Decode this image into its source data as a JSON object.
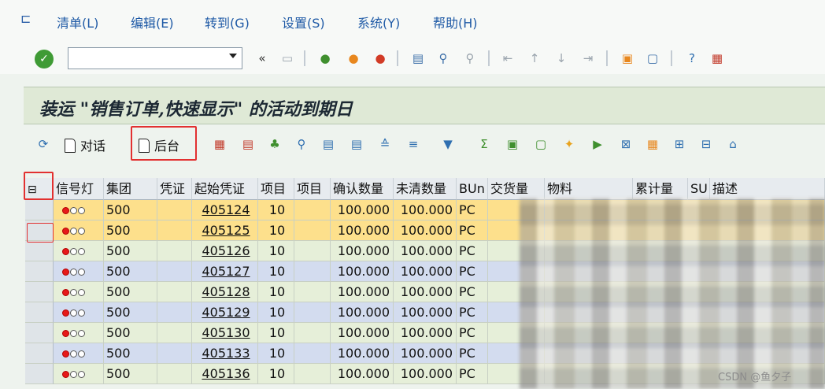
{
  "menu": [
    "清单(L)",
    "编辑(E)",
    "转到(G)",
    "设置(S)",
    "系统(Y)",
    "帮助(H)"
  ],
  "command_field": {
    "value": ""
  },
  "screen_title": "装运 \"销售订单,快速显示\" 的活动到期日",
  "alv_toolbar": {
    "dialog_label": "对话",
    "background_label": "后台"
  },
  "table": {
    "headers": [
      "信号灯",
      "集团",
      "凭证",
      "起始凭证",
      "项目",
      "项目",
      "确认数量",
      "未清数量",
      "BUn",
      "交货量",
      "物料",
      "累计量",
      "SU",
      "描述"
    ],
    "rows": [
      {
        "group": "500",
        "doc": "405124",
        "item": "10",
        "confirmed": "100.000",
        "open": "100.000",
        "bun": "PC"
      },
      {
        "group": "500",
        "doc": "405125",
        "item": "10",
        "confirmed": "100.000",
        "open": "100.000",
        "bun": "PC"
      },
      {
        "group": "500",
        "doc": "405126",
        "item": "10",
        "confirmed": "100.000",
        "open": "100.000",
        "bun": "PC"
      },
      {
        "group": "500",
        "doc": "405127",
        "item": "10",
        "confirmed": "100.000",
        "open": "100.000",
        "bun": "PC"
      },
      {
        "group": "500",
        "doc": "405128",
        "item": "10",
        "confirmed": "100.000",
        "open": "100.000",
        "bun": "PC"
      },
      {
        "group": "500",
        "doc": "405129",
        "item": "10",
        "confirmed": "100.000",
        "open": "100.000",
        "bun": "PC"
      },
      {
        "group": "500",
        "doc": "405130",
        "item": "10",
        "confirmed": "100.000",
        "open": "100.000",
        "bun": "PC"
      },
      {
        "group": "500",
        "doc": "405133",
        "item": "10",
        "confirmed": "100.000",
        "open": "100.000",
        "bun": "PC"
      },
      {
        "group": "500",
        "doc": "405136",
        "item": "10",
        "confirmed": "100.000",
        "open": "100.000",
        "bun": "PC"
      }
    ]
  },
  "colors": {
    "row_yellow": "#fde08c",
    "row_green": "#e6efd9",
    "row_blue": "#d3dcef",
    "highlight_red": "#e23030"
  },
  "icons": [
    "menu-icon",
    "ok-icon",
    "back-icon",
    "exit-icon",
    "cancel-icon",
    "print-icon",
    "find-icon",
    "help-icon",
    "refresh-icon",
    "sort-ascending-icon",
    "filter-icon",
    "sum-icon",
    "layout-icon"
  ],
  "watermark": "CSDN @鱼夕子"
}
